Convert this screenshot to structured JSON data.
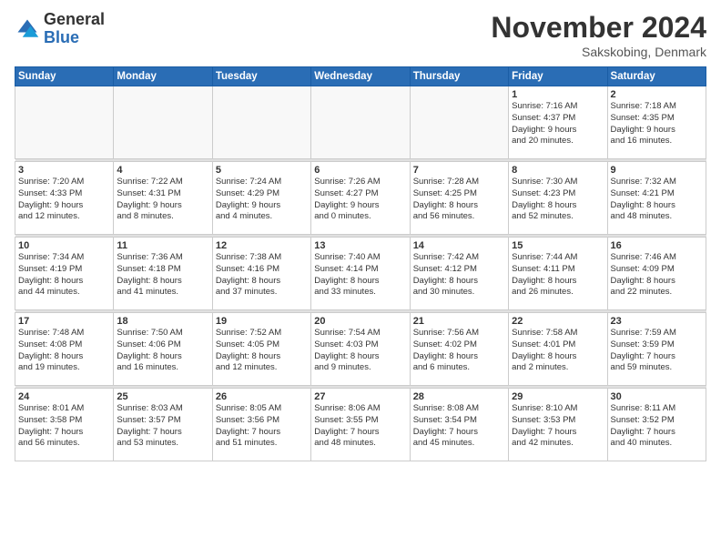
{
  "header": {
    "logo_general": "General",
    "logo_blue": "Blue",
    "month_title": "November 2024",
    "location": "Sakskobing, Denmark"
  },
  "weekdays": [
    "Sunday",
    "Monday",
    "Tuesday",
    "Wednesday",
    "Thursday",
    "Friday",
    "Saturday"
  ],
  "weeks": [
    [
      {
        "day": "",
        "info": ""
      },
      {
        "day": "",
        "info": ""
      },
      {
        "day": "",
        "info": ""
      },
      {
        "day": "",
        "info": ""
      },
      {
        "day": "",
        "info": ""
      },
      {
        "day": "1",
        "info": "Sunrise: 7:16 AM\nSunset: 4:37 PM\nDaylight: 9 hours\nand 20 minutes."
      },
      {
        "day": "2",
        "info": "Sunrise: 7:18 AM\nSunset: 4:35 PM\nDaylight: 9 hours\nand 16 minutes."
      }
    ],
    [
      {
        "day": "3",
        "info": "Sunrise: 7:20 AM\nSunset: 4:33 PM\nDaylight: 9 hours\nand 12 minutes."
      },
      {
        "day": "4",
        "info": "Sunrise: 7:22 AM\nSunset: 4:31 PM\nDaylight: 9 hours\nand 8 minutes."
      },
      {
        "day": "5",
        "info": "Sunrise: 7:24 AM\nSunset: 4:29 PM\nDaylight: 9 hours\nand 4 minutes."
      },
      {
        "day": "6",
        "info": "Sunrise: 7:26 AM\nSunset: 4:27 PM\nDaylight: 9 hours\nand 0 minutes."
      },
      {
        "day": "7",
        "info": "Sunrise: 7:28 AM\nSunset: 4:25 PM\nDaylight: 8 hours\nand 56 minutes."
      },
      {
        "day": "8",
        "info": "Sunrise: 7:30 AM\nSunset: 4:23 PM\nDaylight: 8 hours\nand 52 minutes."
      },
      {
        "day": "9",
        "info": "Sunrise: 7:32 AM\nSunset: 4:21 PM\nDaylight: 8 hours\nand 48 minutes."
      }
    ],
    [
      {
        "day": "10",
        "info": "Sunrise: 7:34 AM\nSunset: 4:19 PM\nDaylight: 8 hours\nand 44 minutes."
      },
      {
        "day": "11",
        "info": "Sunrise: 7:36 AM\nSunset: 4:18 PM\nDaylight: 8 hours\nand 41 minutes."
      },
      {
        "day": "12",
        "info": "Sunrise: 7:38 AM\nSunset: 4:16 PM\nDaylight: 8 hours\nand 37 minutes."
      },
      {
        "day": "13",
        "info": "Sunrise: 7:40 AM\nSunset: 4:14 PM\nDaylight: 8 hours\nand 33 minutes."
      },
      {
        "day": "14",
        "info": "Sunrise: 7:42 AM\nSunset: 4:12 PM\nDaylight: 8 hours\nand 30 minutes."
      },
      {
        "day": "15",
        "info": "Sunrise: 7:44 AM\nSunset: 4:11 PM\nDaylight: 8 hours\nand 26 minutes."
      },
      {
        "day": "16",
        "info": "Sunrise: 7:46 AM\nSunset: 4:09 PM\nDaylight: 8 hours\nand 22 minutes."
      }
    ],
    [
      {
        "day": "17",
        "info": "Sunrise: 7:48 AM\nSunset: 4:08 PM\nDaylight: 8 hours\nand 19 minutes."
      },
      {
        "day": "18",
        "info": "Sunrise: 7:50 AM\nSunset: 4:06 PM\nDaylight: 8 hours\nand 16 minutes."
      },
      {
        "day": "19",
        "info": "Sunrise: 7:52 AM\nSunset: 4:05 PM\nDaylight: 8 hours\nand 12 minutes."
      },
      {
        "day": "20",
        "info": "Sunrise: 7:54 AM\nSunset: 4:03 PM\nDaylight: 8 hours\nand 9 minutes."
      },
      {
        "day": "21",
        "info": "Sunrise: 7:56 AM\nSunset: 4:02 PM\nDaylight: 8 hours\nand 6 minutes."
      },
      {
        "day": "22",
        "info": "Sunrise: 7:58 AM\nSunset: 4:01 PM\nDaylight: 8 hours\nand 2 minutes."
      },
      {
        "day": "23",
        "info": "Sunrise: 7:59 AM\nSunset: 3:59 PM\nDaylight: 7 hours\nand 59 minutes."
      }
    ],
    [
      {
        "day": "24",
        "info": "Sunrise: 8:01 AM\nSunset: 3:58 PM\nDaylight: 7 hours\nand 56 minutes."
      },
      {
        "day": "25",
        "info": "Sunrise: 8:03 AM\nSunset: 3:57 PM\nDaylight: 7 hours\nand 53 minutes."
      },
      {
        "day": "26",
        "info": "Sunrise: 8:05 AM\nSunset: 3:56 PM\nDaylight: 7 hours\nand 51 minutes."
      },
      {
        "day": "27",
        "info": "Sunrise: 8:06 AM\nSunset: 3:55 PM\nDaylight: 7 hours\nand 48 minutes."
      },
      {
        "day": "28",
        "info": "Sunrise: 8:08 AM\nSunset: 3:54 PM\nDaylight: 7 hours\nand 45 minutes."
      },
      {
        "day": "29",
        "info": "Sunrise: 8:10 AM\nSunset: 3:53 PM\nDaylight: 7 hours\nand 42 minutes."
      },
      {
        "day": "30",
        "info": "Sunrise: 8:11 AM\nSunset: 3:52 PM\nDaylight: 7 hours\nand 40 minutes."
      }
    ]
  ]
}
